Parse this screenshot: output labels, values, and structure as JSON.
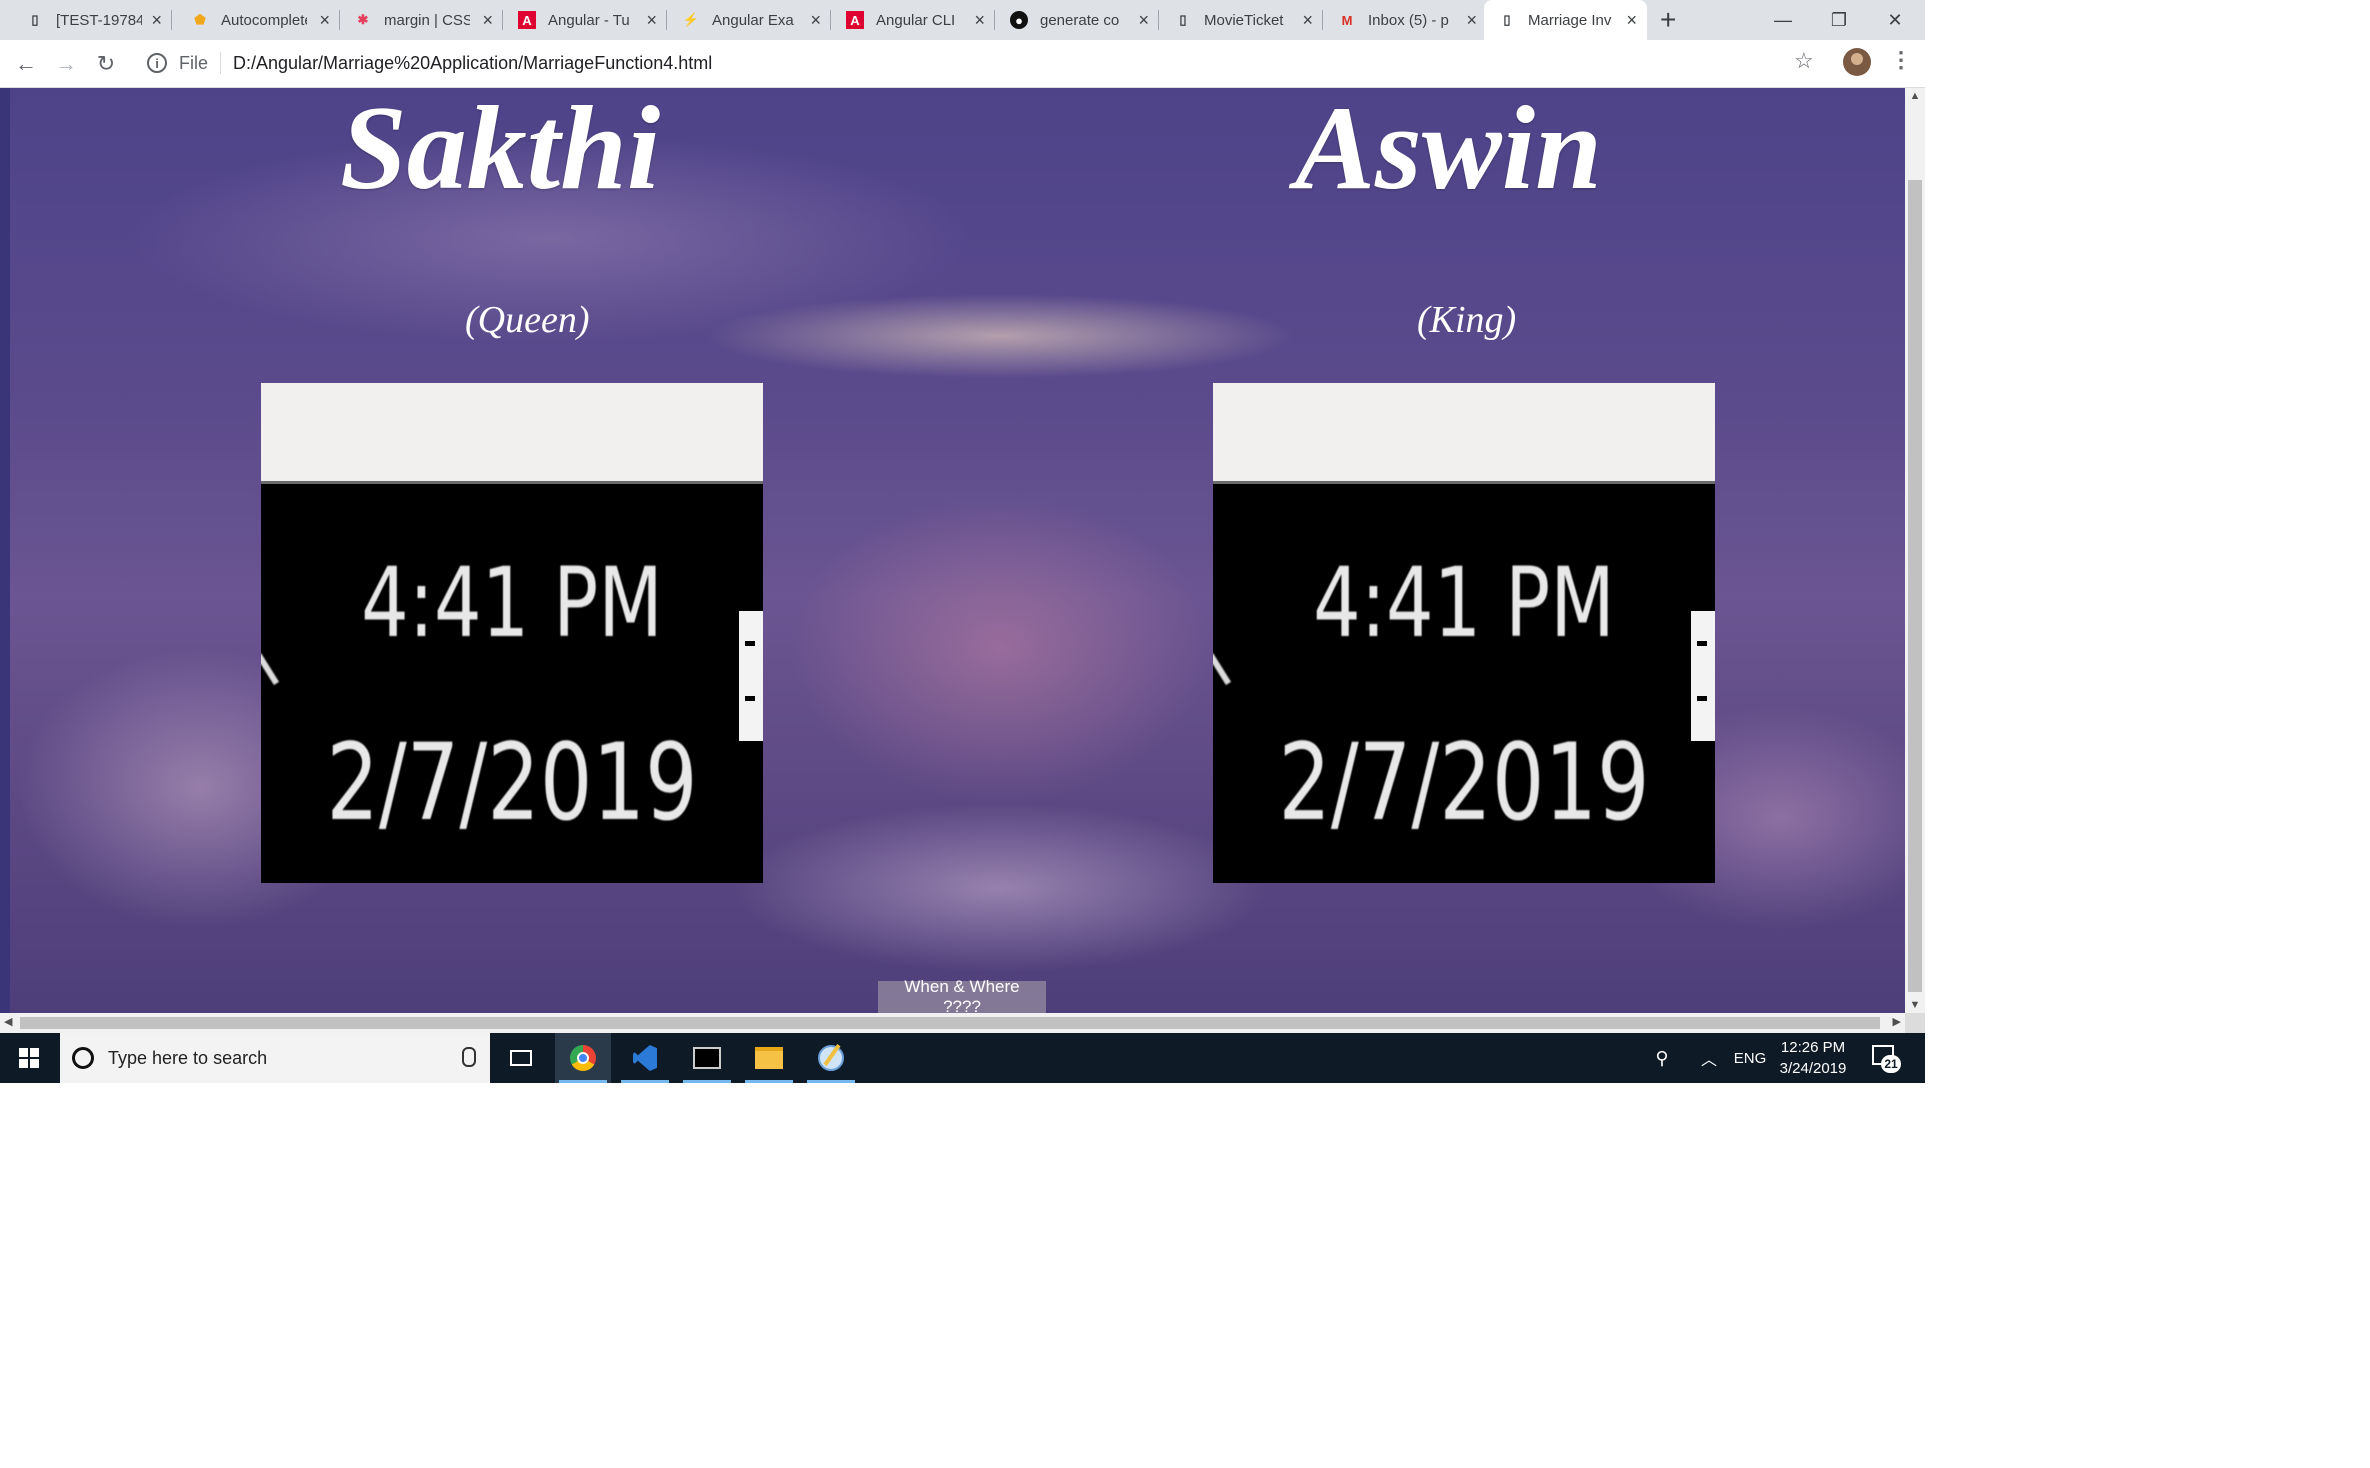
{
  "browser": {
    "tabs": [
      {
        "label": "[TEST-19784",
        "icon": "page-icon"
      },
      {
        "label": "Autocomplete",
        "icon": "shield-icon"
      },
      {
        "label": "margin | CSS",
        "icon": "css-tricks-icon"
      },
      {
        "label": "Angular - Tu",
        "icon": "angular-icon"
      },
      {
        "label": "Angular Exa",
        "icon": "stackblitz-icon"
      },
      {
        "label": "Angular CLI",
        "icon": "angular-icon"
      },
      {
        "label": "generate co",
        "icon": "github-icon"
      },
      {
        "label": "MovieTicket",
        "icon": "page-icon"
      },
      {
        "label": "Inbox (5) - p",
        "icon": "gmail-icon"
      },
      {
        "label": "Marriage Inv",
        "icon": "page-icon",
        "active": true
      }
    ],
    "address": {
      "scheme_label": "File",
      "url": "D:/Angular/Marriage%20Application/MarriageFunction4.html"
    }
  },
  "page": {
    "bride_name": "Sakthi",
    "groom_name": "Aswin",
    "bride_role": "(Queen)",
    "groom_role": "(King)",
    "photo_left": {
      "time": "4:41 PM",
      "date": "2/7/2019"
    },
    "photo_right": {
      "time": "4:41 PM",
      "date": "2/7/2019"
    },
    "when_where_button": "When & Where ????"
  },
  "taskbar": {
    "search_placeholder": "Type here to search",
    "language": "ENG",
    "clock_time": "12:26 PM",
    "clock_date": "3/24/2019",
    "notification_count": "21"
  },
  "colors": {
    "overlay_purple": "#4e4389",
    "taskbar": "#0e1a26",
    "tabbar": "#dee1e6"
  }
}
